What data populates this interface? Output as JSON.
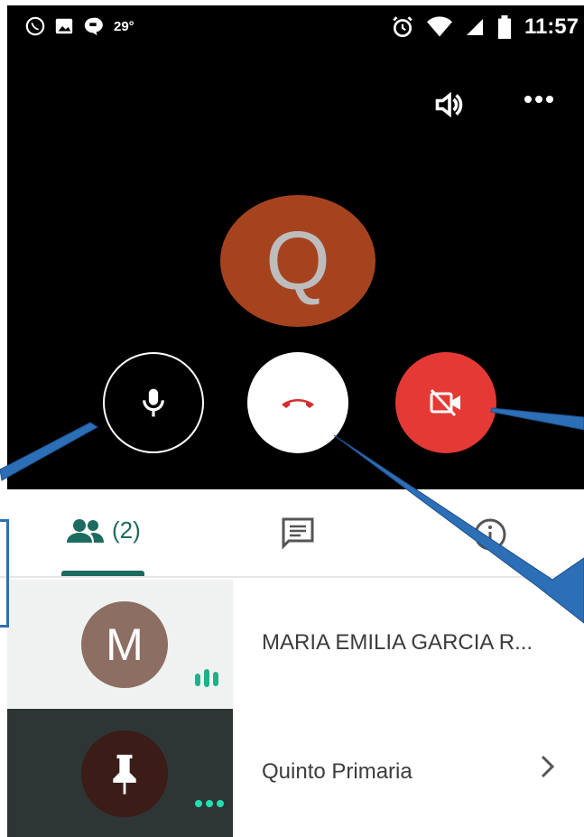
{
  "status_bar": {
    "temperature": "29°",
    "time": "11:57"
  },
  "call": {
    "caller_initial": "Q",
    "caller_color": "#a6431f",
    "mic_icon": "microphone-icon",
    "hangup_icon": "phone-hangup-icon",
    "camera_icon": "video-off-icon",
    "hangup_color": "#e53935",
    "camera_button_color": "#e53935"
  },
  "tabs": [
    {
      "icon": "people-icon",
      "label": "(2)"
    },
    {
      "icon": "chat-icon",
      "label": ""
    },
    {
      "icon": "info-icon",
      "label": ""
    }
  ],
  "participants": [
    {
      "initial": "M",
      "name": "MARIA EMILIA GARCIA R...",
      "status_icon": "speaking-indicator-icon"
    },
    {
      "initial": "",
      "name": "Quinto Primaria",
      "status_icon": "more-dots-icon",
      "avatar_icon": "pin-icon"
    }
  ],
  "colors": {
    "accent": "#1d6b5e",
    "annotation_arrow": "#2d6fb7"
  }
}
